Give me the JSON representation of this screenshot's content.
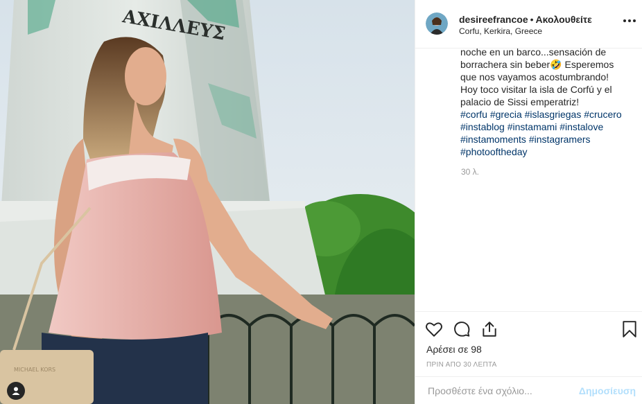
{
  "post": {
    "monument_inscription": "ΑΧΙΛΛΕΥΣ",
    "bag_brand": "MICHAEL KORS"
  },
  "header": {
    "username": "desireefrancoe",
    "dot": "•",
    "follow_label": "Ακολουθείτε",
    "location": "Corfu, Kerkira, Greece"
  },
  "caption": {
    "lines": [
      "noche en un barco...sensación de",
      "borrachera sin beber🤣 Esperemos",
      "que nos vayamos acostumbrando!",
      "Hoy toco visitar la isla de Corfú y el",
      "palacio de Sissi emperatriz!"
    ],
    "hashtags": [
      [
        "#corfu",
        "#grecia",
        "#islasgriegas",
        "#crucero"
      ],
      [
        "#instablog",
        "#instamami",
        "#instalove"
      ],
      [
        "#instamoments",
        "#instagramers"
      ],
      [
        "#photooftheday"
      ]
    ],
    "ago": "30 λ."
  },
  "actions": {
    "icons": [
      "heart-icon",
      "comment-icon",
      "share-icon",
      "bookmark-icon"
    ],
    "likes": "Αρέσει σε 98",
    "timestamp": "ΠΡΙΝ ΑΠΟ 30 ΛΕΠΤΑ"
  },
  "comment": {
    "placeholder": "Προσθέστε ένα σχόλιο...",
    "publish_label": "Δημοσίευση"
  },
  "colors": {
    "link": "#003569",
    "publish_disabled": "#b2dffc",
    "text": "#262626",
    "muted": "#999999"
  }
}
